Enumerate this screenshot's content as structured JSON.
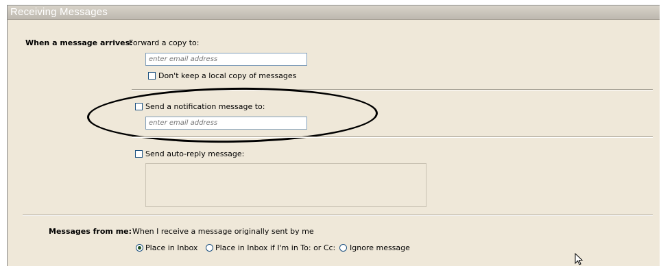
{
  "section": {
    "title": "Receiving Messages"
  },
  "arrival": {
    "label": "When a message arrives:",
    "forward_label": "Forward a copy to:",
    "forward_placeholder": "enter email address",
    "dont_keep_label": "Don't keep a local copy of messages"
  },
  "notification": {
    "checkbox_label": "Send a notification message to:",
    "placeholder": "enter email address"
  },
  "auto_reply": {
    "checkbox_label": "Send auto-reply message:"
  },
  "from_me": {
    "label": "Messages from me:",
    "description": "When I receive a message originally sent by me",
    "options": [
      {
        "label": "Place in Inbox",
        "selected": true
      },
      {
        "label": "Place in Inbox if I'm in To: or Cc:",
        "selected": false
      },
      {
        "label": "Ignore message",
        "selected": false
      }
    ]
  },
  "annotation": {
    "shape": "ellipse-highlight",
    "color": "#000000"
  },
  "icons": {
    "cursor": "mouse-pointer-icon"
  }
}
